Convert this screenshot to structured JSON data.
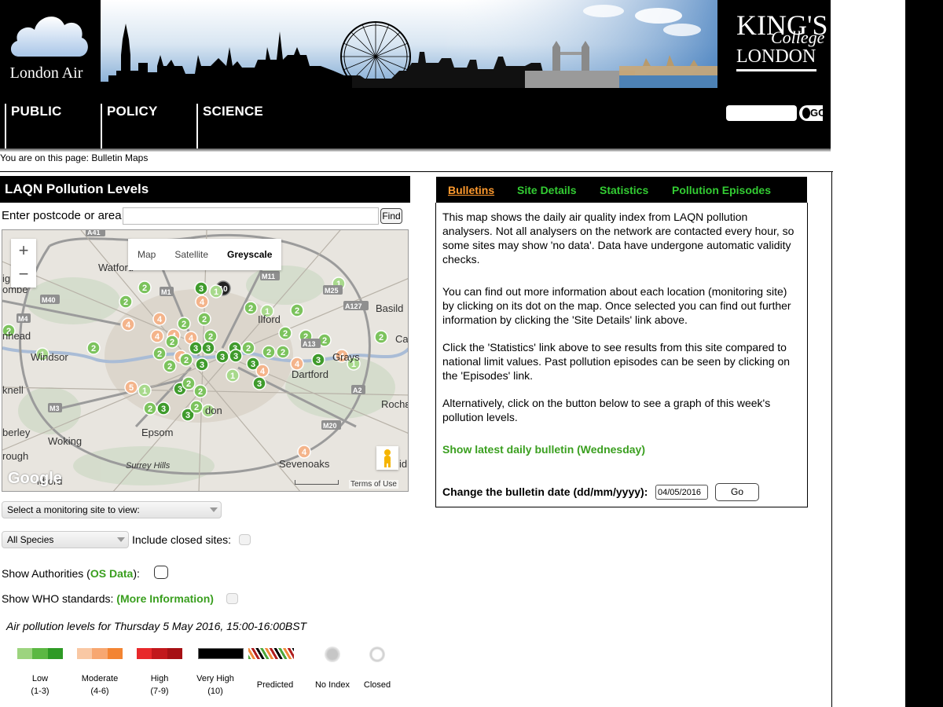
{
  "header": {
    "logo_text": "London Air",
    "kcl_line1": "KING'S",
    "kcl_line2": "College",
    "kcl_line3": "LONDON"
  },
  "nav": {
    "items": [
      "PUBLIC",
      "POLICY",
      "SCIENCE"
    ],
    "search_button": "GO"
  },
  "breadcrumb": "You are on this page: Bulletin Maps",
  "left": {
    "title": "LAQN Pollution Levels",
    "postcode_label": "Enter postcode or area:",
    "postcode_value": "",
    "find_button": "Find",
    "map": {
      "type_buttons": [
        "Map",
        "Satellite",
        "Greyscale"
      ],
      "selected_type": "Greyscale",
      "zoom_in": "+",
      "zoom_out": "−",
      "places": [
        "Watford",
        "Ilford",
        "Basild",
        "nhead",
        "Windsor",
        "Dartford",
        "knell",
        "Rochε",
        "don",
        "Epsom",
        "Woking",
        "berley",
        "rough",
        "Surrey Hills",
        "Sevenoaks",
        "ldford",
        "ombe",
        "ig",
        "Ca",
        "id",
        "Grays"
      ],
      "road_labels": [
        "M1",
        "M11",
        "M25",
        "M40",
        "M3",
        "M20",
        "A2",
        "A13",
        "A127",
        "A41",
        "M4"
      ],
      "google": "Google",
      "terms": "Terms of Use"
    },
    "site_select": "Select a monitoring site to view:",
    "species_select": "All Species",
    "closed_label": "Include closed sites:",
    "auth_label_prefix": "Show Authorities (",
    "auth_link": "OS Data",
    "auth_label_suffix": "):",
    "who_label": "Show WHO standards: ",
    "who_link": "(More Information)",
    "levels_caption": "Air pollution levels for Thursday 5 May 2016, 15:00-16:00BST",
    "legend": [
      {
        "label": "Low",
        "range": "(1-3)"
      },
      {
        "label": "Moderate",
        "range": "(4-6)"
      },
      {
        "label": "High",
        "range": "(7-9)"
      },
      {
        "label": "Very High",
        "range": "(10)"
      },
      {
        "label": "Predicted",
        "range": ""
      },
      {
        "label": "No Index",
        "range": ""
      },
      {
        "label": "Closed",
        "range": ""
      }
    ],
    "colors": {
      "low": [
        "#9dd47f",
        "#5cb843",
        "#2e9a25"
      ],
      "moderate": [
        "#f9c8a4",
        "#f7a771",
        "#f38432"
      ],
      "high": [
        "#e8282a",
        "#c2181c",
        "#a61014"
      ],
      "very_high": "#000000",
      "no_index": "#c8c8c8"
    }
  },
  "right": {
    "tabs": [
      "Bulletins",
      "Site Details",
      "Statistics",
      "Pollution Episodes"
    ],
    "active_tab": "Bulletins",
    "paragraphs": [
      "This map shows the daily air quality index from LAQN pollution analysers. Not all analysers on the network are contacted every hour, so some sites may show 'no data'. Data have undergone automatic validity checks.",
      "You can find out more information about each location (monitoring site) by clicking on its dot on the map. Once selected you can find out further information by clicking the 'Site Details' link above.",
      "Click the 'Statistics' link above to see results from this site compared to national limit values. Past pollution episodes can be seen by clicking on the 'Episodes' link.",
      "Alternatively, click on the button below to see a graph of this week's pollution levels."
    ],
    "bulletin_link": "Show latest daily bulletin (Wednesday)",
    "date_label": "Change the bulletin date (dd/mm/yyyy):",
    "date_value": "04/05/2016",
    "go_button": "Go"
  }
}
